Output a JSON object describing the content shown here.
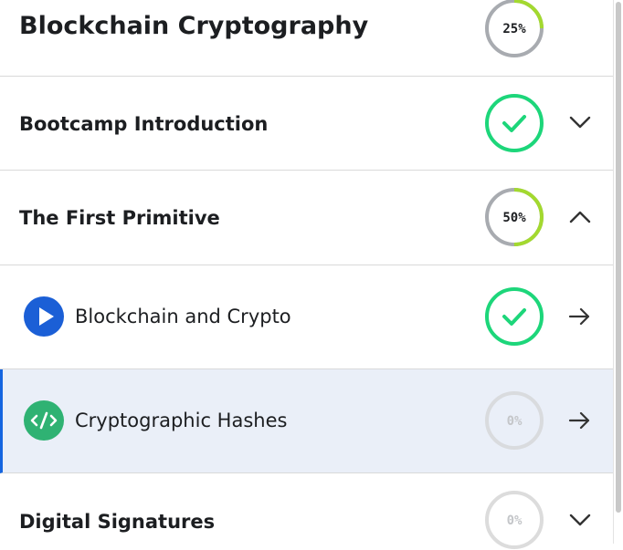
{
  "course": {
    "title": "Blockchain Cryptography",
    "progress_label": "25%",
    "progress": 0.25
  },
  "sections": [
    {
      "title": "Bootcamp Introduction",
      "status": "complete",
      "expanded": false,
      "toggle_icon": "chevron-down-icon"
    },
    {
      "title": "The First Primitive",
      "status": "in-progress",
      "progress_label": "50%",
      "progress": 0.5,
      "expanded": true,
      "toggle_icon": "chevron-up-icon",
      "lessons": [
        {
          "title": "Blockchain and Crypto",
          "type_icon": "play-icon",
          "status": "complete",
          "action_icon": "arrow-right-icon"
        },
        {
          "title": "Cryptographic Hashes",
          "type_icon": "code-icon",
          "status": "not-started",
          "progress_label": "0%",
          "progress": 0,
          "selected": true,
          "action_icon": "arrow-right-icon"
        }
      ]
    },
    {
      "title": "Digital Signatures",
      "status": "not-started",
      "progress_label": "0%",
      "progress": 0,
      "expanded": false,
      "toggle_icon": "chevron-down-icon"
    }
  ],
  "colors": {
    "complete": "#1dd67a",
    "progress_arc": "#a3d92f",
    "ring_track": "#a8abb0",
    "inactive_ring": "#dcdcdc",
    "selected_bg": "#eaeff8",
    "selected_border": "#1565e0",
    "play_icon_bg": "#1b5fd6",
    "code_icon_bg": "#2fb273"
  }
}
